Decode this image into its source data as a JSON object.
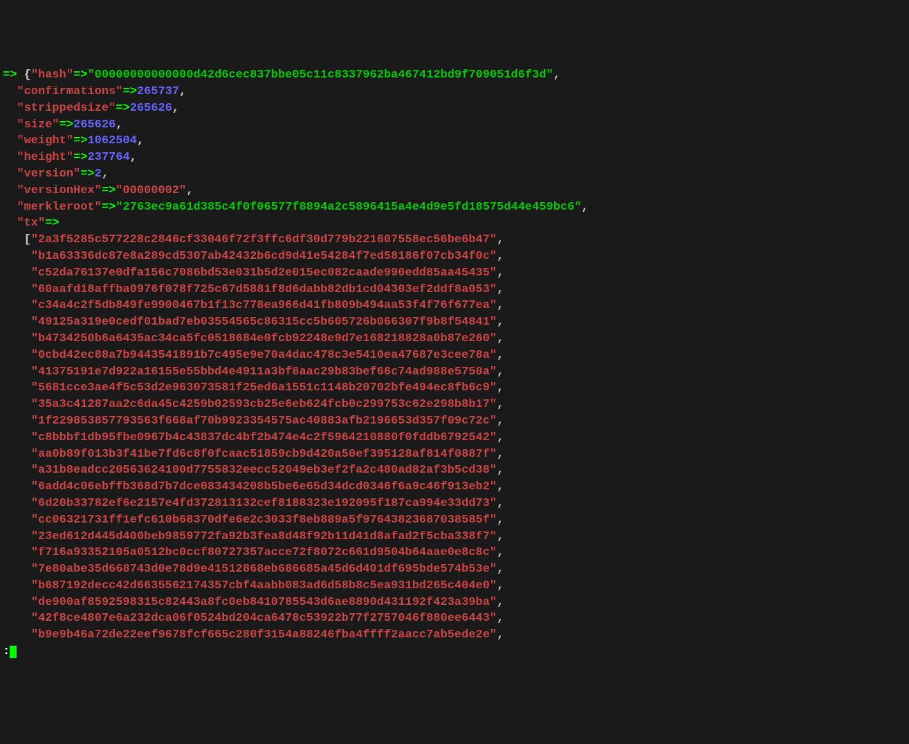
{
  "arrow": "=>",
  "hash_key": "\"hash\"",
  "hash_arrow": "=>",
  "hash_val": "\"00000000000000d42d6cec837bbe05c11c8337962ba467412bd9f709051d6f3d\"",
  "confirmations_key": "\"confirmations\"",
  "confirmations_val": "265737",
  "strippedsize_key": "\"strippedsize\"",
  "strippedsize_val": "265626",
  "size_key": "\"size\"",
  "size_val": "265626",
  "weight_key": "\"weight\"",
  "weight_val": "1062504",
  "height_key": "\"height\"",
  "height_val": "237764",
  "version_key": "\"version\"",
  "version_val": "2",
  "versionHex_key": "\"versionHex\"",
  "versionHex_val": "\"00000002\"",
  "merkleroot_key": "\"merkleroot\"",
  "merkleroot_val": "\"2763ec9a61d385c4f0f06577f8894a2c5896415a4e4d9e5fd18575d44e459bc6\"",
  "tx_key": "\"tx\"",
  "tx": [
    "\"2a3f5285c577228c2846cf33046f72f3ffc6df30d779b221607558ec56be6b47\"",
    "\"b1a63336dc87e8a289cd5307ab42432b6cd9d41e54284f7ed58186f07cb34f0c\"",
    "\"c52da76137e0dfa156c7086bd53e031b5d2e015ec082caade990edd85aa45435\"",
    "\"60aafd18affba0976f078f725c67d5881f8d6dabb82db1cd04303ef2ddf8a053\"",
    "\"c34a4c2f5db849fe9900467b1f13c778ea966d41fb809b494aa53f4f76f677ea\"",
    "\"49125a319e0cedf01bad7eb03554565c86315cc5b605726b066307f9b8f54841\"",
    "\"b4734250b6a6435ac34ca5fc0518684e0fcb92248e9d7e168218828a0b87e260\"",
    "\"0cbd42ec88a7b9443541891b7c495e9e70a4dac478c3e5410ea47687e3cee78a\"",
    "\"41375191e7d922a16155e55bbd4e4911a3bf8aac29b83bef66c74ad988e5750a\"",
    "\"5681cce3ae4f5c53d2e963073581f25ed6a1551c1148b20702bfe494ec8fb6c9\"",
    "\"35a3c41287aa2c6da45c4259b02593cb25e6eb624fcb0c299753c62e298b8b17\"",
    "\"1f229853857793563f668af70b9923354575ac40883afb2196653d357f09c72c\"",
    "\"c8bbbf1db95fbe0967b4c43837dc4bf2b474e4c2f5964210880f0fddb6792542\"",
    "\"aa0b89f013b3f41be7fd6c8f0fcaac51859cb9d420a50ef395128af814f0887f\"",
    "\"a31b8eadcc20563624100d7755832eecc52049eb3ef2fa2c480ad82af3b5cd38\"",
    "\"6add4c06ebffb368d7b7dce083434208b5be6e65d34dcd0346f6a9c46f913eb2\"",
    "\"6d20b33782ef6e2157e4fd372813132cef8188323e192095f187ca994e33dd73\"",
    "\"cc06321731ff1efc610b68370dfe6e2c3033f8eb889a5f97643823687038585f\"",
    "\"23ed612d445d400beb9859772fa92b3fea8d48f92b11d41d8afad2f5cba338f7\"",
    "\"f716a93352105a0512bc0ccf80727357acce72f8072c661d9504b64aae0e8c8c\"",
    "\"7e80abe35d668743d0e78d9e41512868eb686685a45d6d401df695bde574b53e\"",
    "\"b687192decc42d6635562174357cbf4aabb083ad6d58b8c5ea931bd265c404e0\"",
    "\"de900af8592598315c82443a8fc0eb8410785543d6ae8890d431192f423a39ba\"",
    "\"42f8ce4807e6a232dca06f0524bd204ca6478c53922b77f2757046f880ee6443\"",
    "\"b9e9b46a72de22eef9678fcf665c280f3154a88246fba4ffff2aacc7ab5ede2e\""
  ],
  "prompt": ":"
}
